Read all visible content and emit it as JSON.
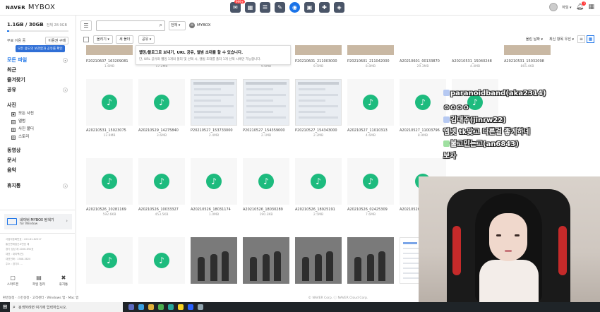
{
  "header": {
    "brand_naver": "NAVER",
    "brand_mybox": "MYBOX",
    "icons": [
      {
        "name": "mail-icon",
        "glyph": "✉",
        "badge": "999+"
      },
      {
        "name": "calendar-icon",
        "glyph": "▦",
        "badge": ""
      },
      {
        "name": "contacts-icon",
        "glyph": "☰",
        "badge": ""
      },
      {
        "name": "memo-icon",
        "glyph": "✎",
        "badge": ""
      },
      {
        "name": "mybox-icon",
        "glyph": "◉",
        "badge": ""
      },
      {
        "name": "cafe-icon",
        "glyph": "▣",
        "badge": ""
      },
      {
        "name": "blog-icon",
        "glyph": "✚",
        "badge": ""
      },
      {
        "name": "pay-icon",
        "glyph": "◈",
        "badge": ""
      }
    ],
    "user_name": "하임 ▾",
    "notification_count": "1"
  },
  "sidebar": {
    "storage_used": "1.1GB / 30GB",
    "storage_detail": "전체 28.9GB",
    "storage_fraction": 0.04,
    "free_label": "무료 이용 중",
    "upgrade_label": "이용권 구매",
    "tooltip": "모든 용도의 보관함과 공유를 확인",
    "nav": [
      {
        "label": "모든 파일",
        "chevron": "▾",
        "selected": true
      },
      {
        "label": "최근",
        "chevron": "",
        "selected": false
      },
      {
        "label": "즐겨찾기",
        "chevron": "",
        "selected": false
      },
      {
        "label": "공유",
        "chevron": "▾",
        "selected": false
      }
    ],
    "photo_label": "사진",
    "photo_sub": [
      {
        "label": "모든 사진",
        "icon": "▣"
      },
      {
        "label": "앨범",
        "icon": "▤"
      },
      {
        "label": "사진 폴더",
        "icon": "▥"
      },
      {
        "label": "스토리",
        "icon": "▧"
      }
    ],
    "other_nav": [
      "동영상",
      "문서",
      "음악"
    ],
    "trash_label": "휴지통",
    "trash_chevron": "▾",
    "promo_title": "네이버 MYBOX 탐색기",
    "promo_sub": "for Window",
    "company_lines": [
      "사업자등록번호 : 220-81-62517",
      "통신판매업신고번호 제",
      "경기 성남 제 2006-692호",
      "대표 : 대리핵(전)",
      "대표전화 : 1588-3820",
      "주소 : 경기도 ..."
    ],
    "tools": [
      {
        "icon": "▢",
        "label": "스마트폰"
      },
      {
        "icon": "▤",
        "label": "파일 정리"
      },
      {
        "icon": "✖",
        "label": "휴지통"
      }
    ],
    "status_left": "환경설정 · 스킨설정 · 고객센터 · Windows 앱 · Mac 앱"
  },
  "toolbar": {
    "menu_glyph": "☰",
    "search_placeholder": "",
    "scope": "전체 ▾",
    "crumb_badge": "M",
    "crumb_label": "MYBOX",
    "upload_label": "올리기 ▾",
    "new_folder_label": "새 폴더",
    "share_label": "공유 ▾",
    "sort_by": "올린 날짜 ▾",
    "sort_order": "최신 항목 우선 ▾",
    "view_list_glyph": "≡",
    "view_grid_glyph": "▦"
  },
  "upload_hint": {
    "title": "웹밍/블로그로 보내기, URL 공유, 앨범 초대를 할 수 있습니다.",
    "sub": "단, URL 공유와 웹밍 1개의 폴더 및 선택 시, 앨범 초대를 폴더 1개 선택 시에만 가능합니다."
  },
  "files": [
    {
      "name": "P20210607_163209081",
      "size": "1.6MB",
      "kind": "partial"
    },
    {
      "name": "A20210607_....",
      "size": "17.2MB",
      "kind": "partial"
    },
    {
      "name": "",
      "size": "",
      "kind": "none"
    },
    {
      "name": "",
      "size": "9.6MB",
      "kind": "partial"
    },
    {
      "name": "P20210601_211003000",
      "size": "9.5MB",
      "kind": "partial"
    },
    {
      "name": "P20210601_211042000",
      "size": "8.8MB",
      "kind": "partial"
    },
    {
      "name": "A20210601_00133870",
      "size": "29.3MB",
      "kind": "none"
    },
    {
      "name": "A20210531_15040248",
      "size": "4.4MB",
      "kind": "none"
    },
    {
      "name": "A20210531_15032098",
      "size": "865.4KB",
      "kind": "partial"
    },
    {
      "name": "A20210531_15023075",
      "size": "12.9MB",
      "kind": "music"
    },
    {
      "name": "A20210529_14275840",
      "size": "3.6MB",
      "kind": "music"
    },
    {
      "name": "P20210527_153733000",
      "size": "2.4MB",
      "kind": "shot"
    },
    {
      "name": "P20210527_154359000",
      "size": "2.1MB",
      "kind": "shot"
    },
    {
      "name": "P20210527_154343000",
      "size": "2.2MB",
      "kind": "shot"
    },
    {
      "name": "A20210527_11010313",
      "size": "4.6MB",
      "kind": "music"
    },
    {
      "name": "A20210527_11003796",
      "size": "8.9MB",
      "kind": "music"
    },
    {
      "name": "",
      "size": "",
      "kind": "music"
    },
    {
      "name": "",
      "size": "",
      "kind": "none"
    },
    {
      "name": "A20210526_20281169",
      "size": "592.6KB",
      "kind": "music"
    },
    {
      "name": "A20210526_10033327",
      "size": "453.5KB",
      "kind": "music"
    },
    {
      "name": "A20210526_18031174",
      "size": "1.0MB",
      "kind": "music"
    },
    {
      "name": "A20210526_18030289",
      "size": "190.3KB",
      "kind": "music"
    },
    {
      "name": "A20210526_18925191",
      "size": "2.5MB",
      "kind": "music"
    },
    {
      "name": "A20210526_02425309",
      "size": "7.6MB",
      "kind": "music"
    },
    {
      "name": "A20210526_00134002",
      "size": "",
      "kind": "music"
    },
    {
      "name": "",
      "size": "",
      "kind": "none"
    },
    {
      "name": "",
      "size": "",
      "kind": "none"
    },
    {
      "name": "",
      "size": "",
      "kind": "music"
    },
    {
      "name": "",
      "size": "",
      "kind": "music"
    },
    {
      "name": "",
      "size": "",
      "kind": "photo"
    },
    {
      "name": "",
      "size": "",
      "kind": "photo"
    },
    {
      "name": "",
      "size": "",
      "kind": "photo"
    },
    {
      "name": "",
      "size": "",
      "kind": "photo"
    },
    {
      "name": "",
      "size": "",
      "kind": "doc"
    },
    {
      "name": "",
      "size": "",
      "kind": "doc"
    },
    {
      "name": "",
      "size": "",
      "kind": "none"
    }
  ],
  "footer": "© NAVER Corp. ⓘ NAVER Cloud Corp.",
  "taskbar": {
    "start_glyph": "⊞",
    "search_glyph": "⌕",
    "search_text": "검색하려면 여기에 입력하십시오."
  },
  "chat": [
    {
      "text": "paranoidband(aka2314)",
      "icon_color": "#b6c9f2"
    },
    {
      "text": "ㅇㅇㅇㅇ",
      "icon_color": ""
    },
    {
      "text": "김대주(jinrw22)",
      "icon_color": "#b6c9f2"
    },
    {
      "text": "엠넷 tk맞고 다른걸 좋게하네",
      "icon_color": ""
    },
    {
      "text": "불고민는고(an6843)",
      "icon_color": "#9fe0a0"
    },
    {
      "text": "보자",
      "icon_color": ""
    }
  ],
  "colors": {
    "accent": "#1a73e8",
    "music_green": "#1dbb7e",
    "badge_red": "#ff4444"
  }
}
